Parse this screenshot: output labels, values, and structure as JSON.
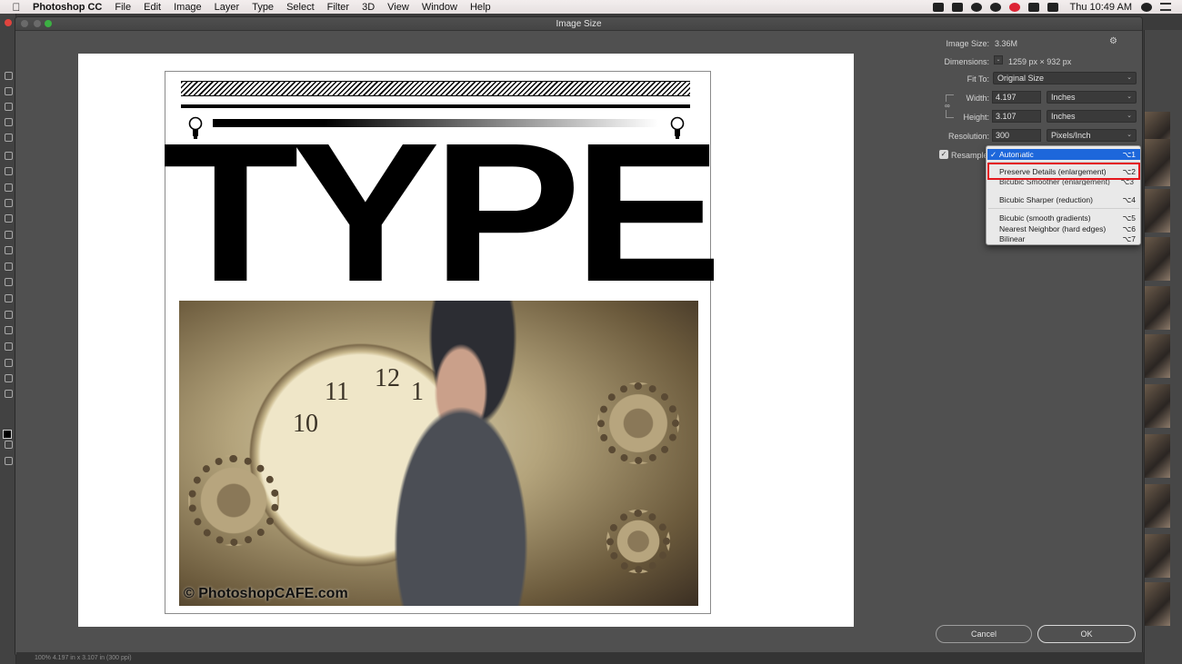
{
  "menubar": {
    "app_name": "Photoshop CC",
    "items": [
      "File",
      "Edit",
      "Image",
      "Layer",
      "Type",
      "Select",
      "Filter",
      "3D",
      "View",
      "Window",
      "Help"
    ],
    "clock": "Thu 10:49 AM"
  },
  "dialog": {
    "title": "Image Size",
    "image_size_label": "Image Size:",
    "image_size_value": "3.36M",
    "dimensions_label": "Dimensions:",
    "dimensions_value": "1259 px  ×  932 px",
    "fit_to_label": "Fit To:",
    "fit_to_value": "Original Size",
    "width_label": "Width:",
    "width_value": "4.197",
    "width_unit": "Inches",
    "height_label": "Height:",
    "height_value": "3.107",
    "height_unit": "Inches",
    "resolution_label": "Resolution:",
    "resolution_value": "300",
    "resolution_unit": "Pixels/Inch",
    "resample_label": "Resample",
    "cancel_label": "Cancel",
    "ok_label": "OK"
  },
  "resample_menu": {
    "items": [
      {
        "label": "Automatic",
        "shortcut": "⌥1",
        "selected": true
      },
      {
        "label": "Preserve Details (enlargement)",
        "shortcut": "⌥2"
      },
      {
        "label": "Bicubic Smoother (enlargement)",
        "shortcut": "⌥3"
      },
      {
        "label": "Bicubic Sharper (reduction)",
        "shortcut": "⌥4"
      },
      {
        "label": "Bicubic (smooth gradients)",
        "shortcut": "⌥5"
      },
      {
        "label": "Nearest Neighbor (hard edges)",
        "shortcut": "⌥6"
      },
      {
        "label": "Bilinear",
        "shortcut": "⌥7"
      }
    ],
    "highlight_color": "#e4161c",
    "selection_color": "#1d67db"
  },
  "preview": {
    "headline": "TYPE",
    "copyright": "© PhotoshopCAFE.com",
    "clock_numbers": [
      "11",
      "12",
      "1",
      "10"
    ]
  },
  "statusbar": {
    "text": "100%     4.197 in x 3.107 in (300 ppi)"
  }
}
